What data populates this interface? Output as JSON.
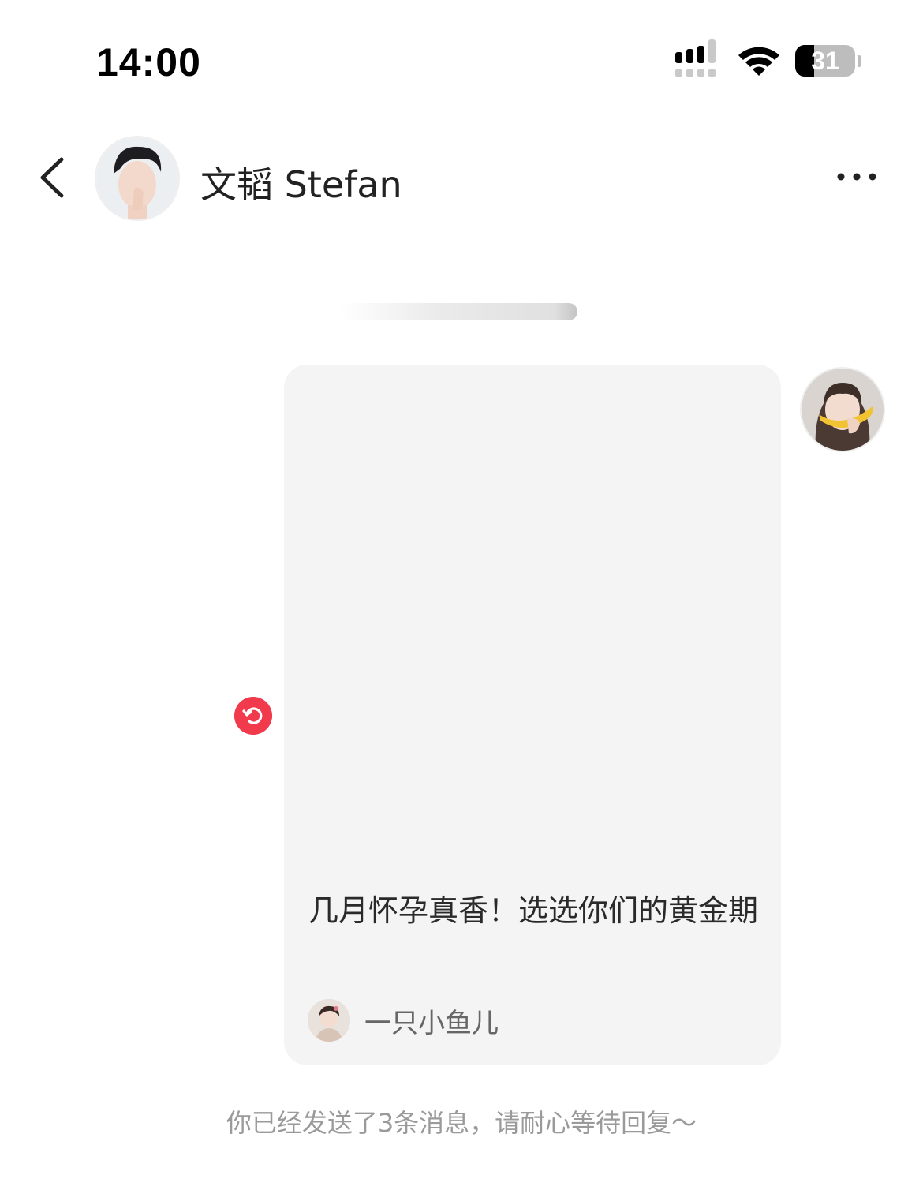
{
  "status_bar": {
    "time": "14:00",
    "battery_level": "31",
    "signal_icon": "cellular-signal-icon",
    "wifi_icon": "wifi-icon",
    "battery_icon": "battery-icon"
  },
  "header": {
    "back_icon": "chevron-left-icon",
    "contact_name": "文韬 Stefan",
    "more_icon": "more-horizontal-icon"
  },
  "message": {
    "card_title": "几月怀孕真香！选选你们的黄金期",
    "author_name": "一只小鱼儿",
    "send_status_icon": "retry-icon"
  },
  "notice": "你已经发送了3条消息，请耐心等待回复～",
  "colors": {
    "accent_red": "#f23a4d",
    "card_background": "#f4f4f4",
    "muted_text": "#9a9a9a"
  }
}
